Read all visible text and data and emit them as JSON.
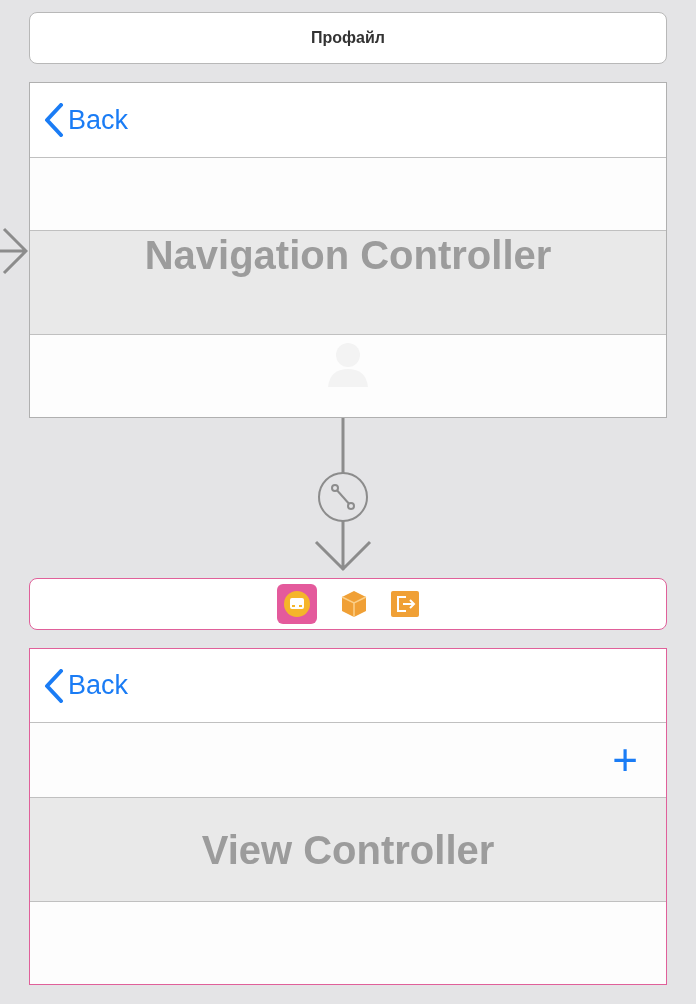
{
  "scene_title": "Профайл",
  "navigation_controller": {
    "back": "Back",
    "title": "Navigation Controller"
  },
  "freelancer_scene": {
    "back": "Back",
    "add": "+",
    "title_lines": [
      "View Controller"
    ],
    "selected": true
  }
}
